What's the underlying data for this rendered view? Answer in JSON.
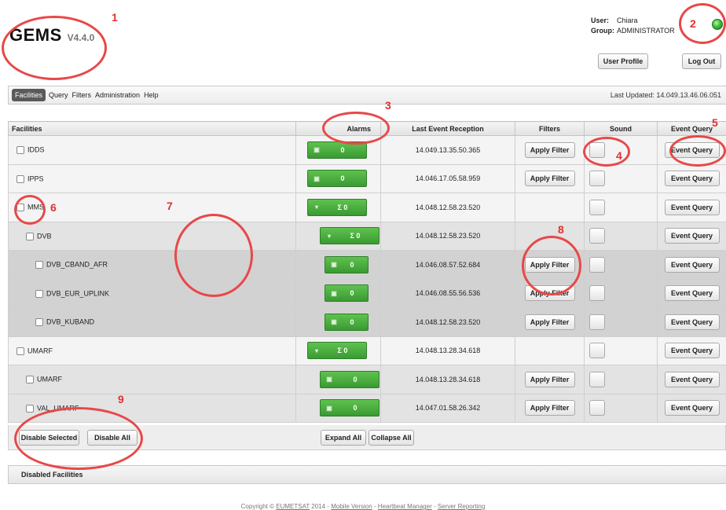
{
  "app": {
    "name": "GEMS",
    "version": "V4.4.0"
  },
  "user": {
    "user_label": "User:",
    "user_name": "Chiara",
    "group_label": "Group:",
    "group_name": "ADMINISTRATOR"
  },
  "header_buttons": {
    "user_profile": "User Profile",
    "logout": "Log Out"
  },
  "nav": {
    "items": [
      "Facilities",
      "Query",
      "Filters",
      "Administration",
      "Help"
    ],
    "active": "Facilities",
    "last_updated": "Last Updated: 14.049.13.46.06.051"
  },
  "table": {
    "headers": [
      "Facilities",
      "Alarms",
      "Last Event Reception",
      "Filters",
      "Sound",
      "Event Query"
    ],
    "rows": [
      {
        "name": "IDDS",
        "level": 0,
        "alarm_icon": "▣",
        "alarm": "0",
        "last_event": "14.049.13.35.50.365",
        "filter": "Apply Filter",
        "query": "Event Query"
      },
      {
        "name": "IPPS",
        "level": 0,
        "alarm_icon": "▣",
        "alarm": "0",
        "last_event": "14.046.17.05.58.959",
        "filter": "Apply Filter",
        "query": "Event Query"
      },
      {
        "name": "MMS",
        "level": 0,
        "alarm_icon": "▾",
        "alarm": "Σ 0",
        "last_event": "14.048.12.58.23.520",
        "filter": "",
        "query": "Event Query"
      },
      {
        "name": "DVB",
        "level": 1,
        "alarm_icon": "▾",
        "alarm": "Σ 0",
        "last_event": "14.048.12.58.23.520",
        "filter": "",
        "query": "Event Query"
      },
      {
        "name": "DVB_CBAND_AFR",
        "level": 2,
        "alarm_icon": "▣",
        "alarm": "0",
        "last_event": "14.046.08.57.52.684",
        "filter": "Apply Filter",
        "query": "Event Query"
      },
      {
        "name": "DVB_EUR_UPLINK",
        "level": 2,
        "alarm_icon": "▣",
        "alarm": "0",
        "last_event": "14.046.08.55.56.536",
        "filter": "Apply Filter",
        "query": "Event Query"
      },
      {
        "name": "DVB_KUBAND",
        "level": 2,
        "alarm_icon": "▣",
        "alarm": "0",
        "last_event": "14.048.12.58.23.520",
        "filter": "Apply Filter",
        "query": "Event Query"
      },
      {
        "name": "UMARF",
        "level": 0,
        "alarm_icon": "▾",
        "alarm": "Σ 0",
        "last_event": "14.048.13.28.34.618",
        "filter": "",
        "query": "Event Query"
      },
      {
        "name": "UMARF",
        "level": 1,
        "alarm_icon": "▣",
        "alarm": "0",
        "last_event": "14.048.13.28.34.618",
        "filter": "Apply Filter",
        "query": "Event Query"
      },
      {
        "name": "VAL_UMARF",
        "level": 1,
        "alarm_icon": "▣",
        "alarm": "0",
        "last_event": "14.047.01.58.26.342",
        "filter": "Apply Filter",
        "query": "Event Query"
      }
    ]
  },
  "actions": {
    "disable_selected": "Disable Selected",
    "disable_all": "Disable All",
    "expand_all": "Expand All",
    "collapse_all": "Collapse All"
  },
  "disabled_section": "Disabled Facilities",
  "footer": {
    "prefix": "Copyright © ",
    "org": "EUMETSAT",
    "year": " 2014 - ",
    "mobile": "Mobile Version",
    "heartbeat": "Heartbeat Manager",
    "server": "Server Reporting",
    "sep": " - "
  },
  "annotations": [
    "1",
    "2",
    "3",
    "4",
    "5",
    "6",
    "7",
    "8",
    "9"
  ],
  "colors": {
    "alarm_green": "#4caf3f",
    "annotation_red": "#e03030",
    "status_led": "#3cc03c"
  }
}
